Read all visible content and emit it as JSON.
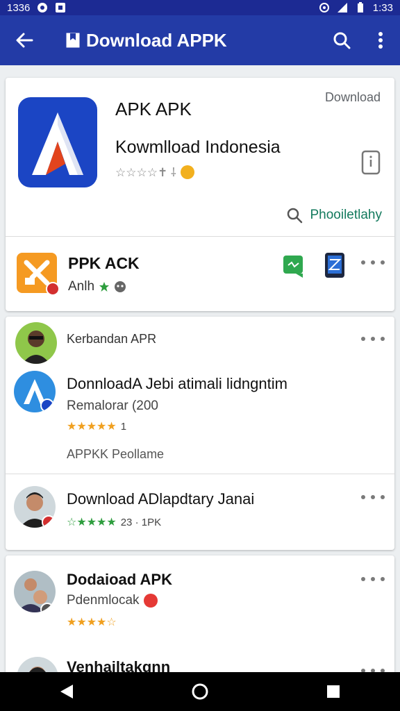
{
  "status_bar": {
    "time_left": "1336",
    "time_right": "1:33"
  },
  "app_bar": {
    "title": "Download APPK"
  },
  "hero": {
    "download_label": "Download",
    "title": "APK APK",
    "subtitle": "Kowmlload Indonesia",
    "rating_text": "☆☆☆☆✝ ⸸",
    "action_label": "Phooiletlahy"
  },
  "featured_row": {
    "title": "PPK ACK",
    "subtitle": "Anlh"
  },
  "post1": {
    "header": "Kerbandan APR",
    "title": "DonnloadA Jebi atimali lidngntim",
    "subtitle": "Remalorar (200",
    "stars": "★★★★★",
    "count": "1",
    "footer": "APPKK Peollame"
  },
  "post2": {
    "title": "Download ADlapdtary Janai",
    "stars": "☆★★★★",
    "count": "23 · 1PK"
  },
  "post3": {
    "title": "Dodaioad APK",
    "subtitle": "Pdenmlocak",
    "stars": "★★★★☆"
  },
  "post4": {
    "title": "Venhailtakgnn"
  },
  "colors": {
    "status_bar": "#1c2a93",
    "app_bar": "#233ba6",
    "brand_blue": "#1b45c4",
    "accent_green": "#137a5d",
    "star": "#f0a020"
  }
}
